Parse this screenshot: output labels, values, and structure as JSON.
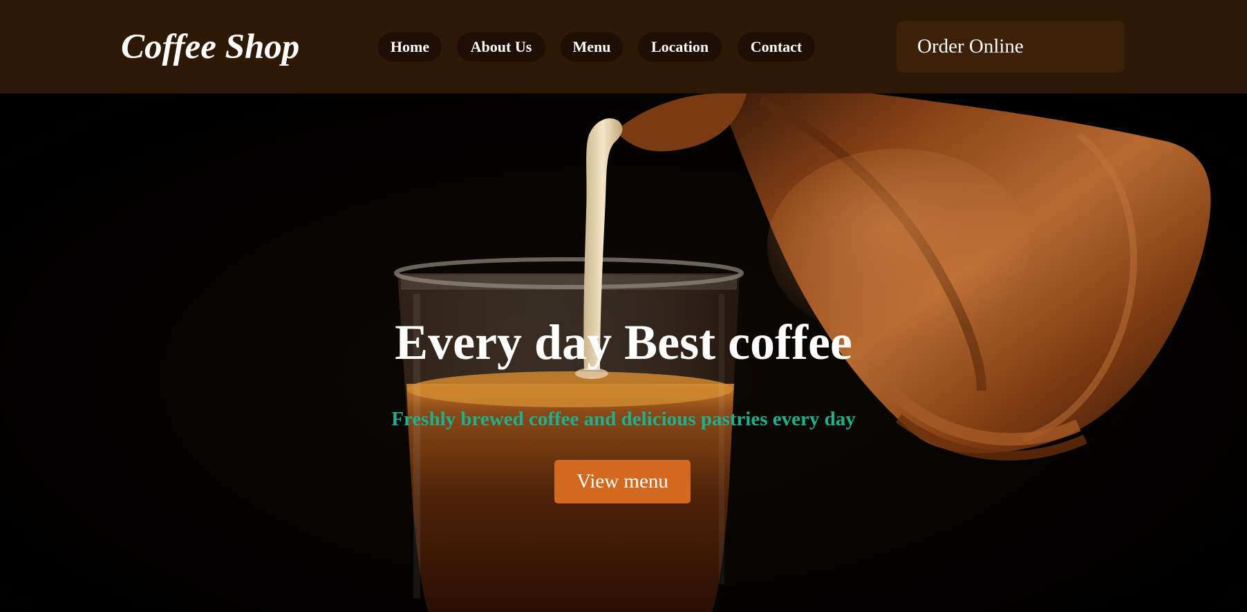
{
  "header": {
    "logo": "Coffee Shop",
    "nav": [
      {
        "label": "Home"
      },
      {
        "label": "About Us"
      },
      {
        "label": "Menu"
      },
      {
        "label": "Location"
      },
      {
        "label": "Contact"
      }
    ],
    "order_button": "Order Online"
  },
  "hero": {
    "title": "Every day Best coffee",
    "subtitle": "Freshly brewed coffee and delicious pastries every day",
    "cta_button": "View menu",
    "background_image": "milk-poured-into-coffee-glass-from-copper-pot"
  },
  "colors": {
    "header_bg": "#2e1906",
    "nav_pill_bg": "#1f0e06",
    "order_button_bg": "#3c2008",
    "subtitle": "#1db190",
    "cta_button_bg": "#d2691e",
    "hero_bg": "#050302"
  }
}
